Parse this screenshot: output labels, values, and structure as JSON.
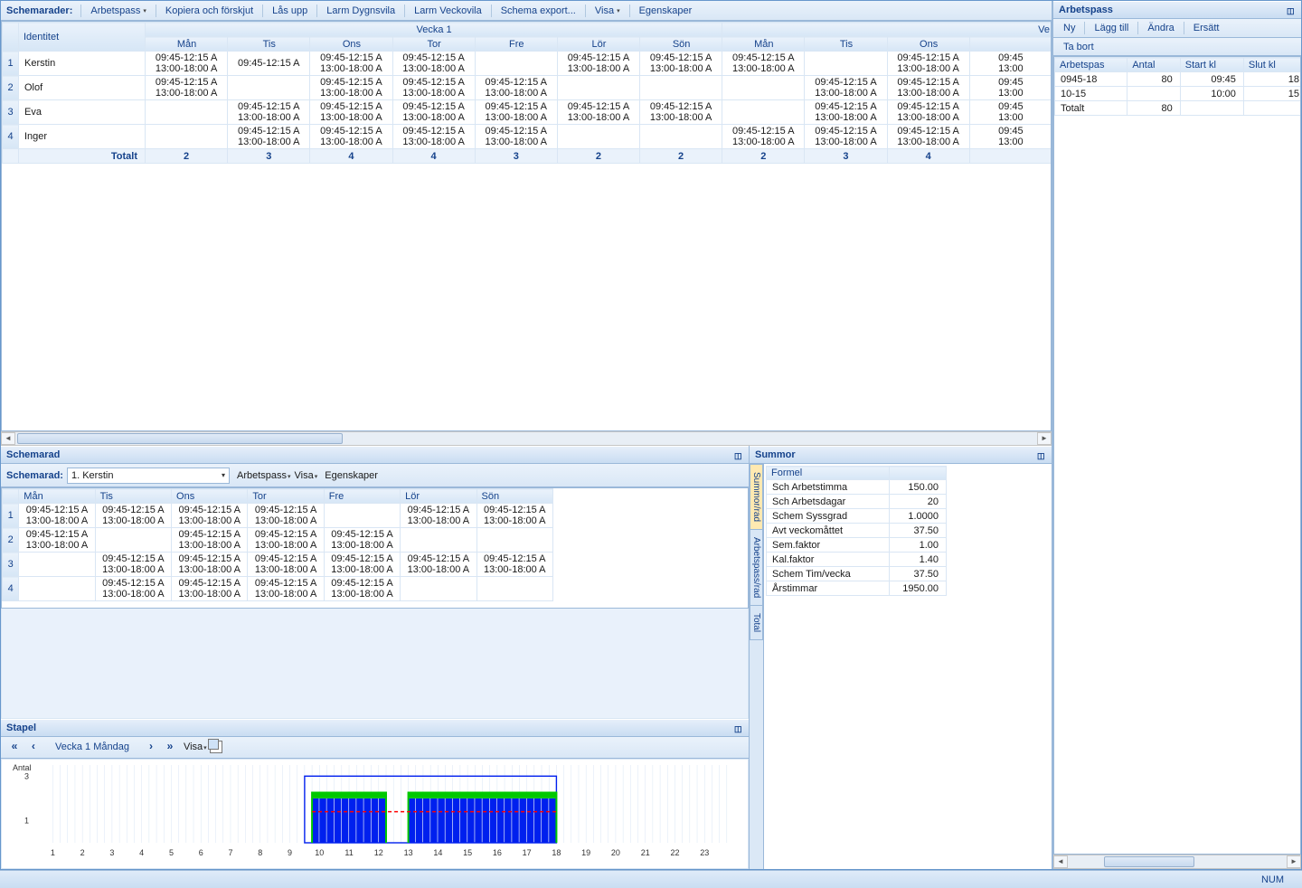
{
  "toolbar": {
    "label": "Schemarader:",
    "arbetspass": "Arbetspass",
    "kopiera": "Kopiera och förskjut",
    "lasupp": "Lås upp",
    "larm_dygn": "Larm Dygnsvila",
    "larm_vecka": "Larm Veckovila",
    "schema_export": "Schema export...",
    "visa": "Visa",
    "egenskaper": "Egenskaper"
  },
  "main_grid": {
    "week_header": "Vecka 1",
    "identitet": "Identitet",
    "days": [
      "Mån",
      "Tis",
      "Ons",
      "Tor",
      "Fre",
      "Lör",
      "Sön",
      "Mån",
      "Tis",
      "Ons",
      ""
    ],
    "partial_header": "Ve",
    "rows": [
      {
        "n": "1",
        "name": "Kerstin",
        "cells": [
          [
            "09:45-12:15 A",
            "13:00-18:00 A"
          ],
          [
            "09:45-12:15 A",
            ""
          ],
          [
            "09:45-12:15 A",
            "13:00-18:00 A"
          ],
          [
            "09:45-12:15 A",
            "13:00-18:00 A"
          ],
          [
            "",
            ""
          ],
          [
            "09:45-12:15 A",
            "13:00-18:00 A"
          ],
          [
            "09:45-12:15 A",
            "13:00-18:00 A"
          ],
          [
            "09:45-12:15 A",
            "13:00-18:00 A"
          ],
          [
            "",
            ""
          ],
          [
            "09:45-12:15 A",
            "13:00-18:00 A"
          ],
          [
            "09:45",
            "13:00"
          ]
        ]
      },
      {
        "n": "2",
        "name": "Olof",
        "cells": [
          [
            "09:45-12:15 A",
            "13:00-18:00 A"
          ],
          [
            "",
            ""
          ],
          [
            "09:45-12:15 A",
            "13:00-18:00 A"
          ],
          [
            "09:45-12:15 A",
            "13:00-18:00 A"
          ],
          [
            "09:45-12:15 A",
            "13:00-18:00 A"
          ],
          [
            "",
            ""
          ],
          [
            "",
            ""
          ],
          [
            "",
            ""
          ],
          [
            "09:45-12:15 A",
            "13:00-18:00 A"
          ],
          [
            "09:45-12:15 A",
            "13:00-18:00 A"
          ],
          [
            "09:45",
            "13:00"
          ]
        ]
      },
      {
        "n": "3",
        "name": "Eva",
        "cells": [
          [
            "",
            ""
          ],
          [
            "09:45-12:15 A",
            "13:00-18:00 A"
          ],
          [
            "09:45-12:15 A",
            "13:00-18:00 A"
          ],
          [
            "09:45-12:15 A",
            "13:00-18:00 A"
          ],
          [
            "09:45-12:15 A",
            "13:00-18:00 A"
          ],
          [
            "09:45-12:15 A",
            "13:00-18:00 A"
          ],
          [
            "09:45-12:15 A",
            "13:00-18:00 A"
          ],
          [
            "",
            ""
          ],
          [
            "09:45-12:15 A",
            "13:00-18:00 A"
          ],
          [
            "09:45-12:15 A",
            "13:00-18:00 A"
          ],
          [
            "09:45",
            "13:00"
          ]
        ]
      },
      {
        "n": "4",
        "name": "Inger",
        "cells": [
          [
            "",
            ""
          ],
          [
            "09:45-12:15 A",
            "13:00-18:00 A"
          ],
          [
            "09:45-12:15 A",
            "13:00-18:00 A"
          ],
          [
            "09:45-12:15 A",
            "13:00-18:00 A"
          ],
          [
            "09:45-12:15 A",
            "13:00-18:00 A"
          ],
          [
            "",
            ""
          ],
          [
            "",
            ""
          ],
          [
            "09:45-12:15 A",
            "13:00-18:00 A"
          ],
          [
            "09:45-12:15 A",
            "13:00-18:00 A"
          ],
          [
            "09:45-12:15 A",
            "13:00-18:00 A"
          ],
          [
            "09:45",
            "13:00"
          ]
        ]
      }
    ],
    "totals_label": "Totalt",
    "totals": [
      "2",
      "3",
      "4",
      "4",
      "3",
      "2",
      "2",
      "2",
      "3",
      "4",
      ""
    ]
  },
  "schemarad_panel": {
    "title": "Schemarad",
    "label": "Schemarad:",
    "combo_value": "1. Kerstin",
    "arbetspass": "Arbetspass",
    "visa": "Visa",
    "egenskaper": "Egenskaper",
    "days": [
      "Mån",
      "Tis",
      "Ons",
      "Tor",
      "Fre",
      "Lör",
      "Sön"
    ],
    "rows": [
      {
        "n": "1",
        "cells": [
          [
            "09:45-12:15 A",
            "13:00-18:00 A"
          ],
          [
            "09:45-12:15 A",
            "13:00-18:00 A"
          ],
          [
            "09:45-12:15 A",
            "13:00-18:00 A"
          ],
          [
            "09:45-12:15 A",
            "13:00-18:00 A"
          ],
          [
            "",
            ""
          ],
          [
            "09:45-12:15 A",
            "13:00-18:00 A"
          ],
          [
            "09:45-12:15 A",
            "13:00-18:00 A"
          ]
        ]
      },
      {
        "n": "2",
        "cells": [
          [
            "09:45-12:15 A",
            "13:00-18:00 A"
          ],
          [
            "",
            ""
          ],
          [
            "09:45-12:15 A",
            "13:00-18:00 A"
          ],
          [
            "09:45-12:15 A",
            "13:00-18:00 A"
          ],
          [
            "09:45-12:15 A",
            "13:00-18:00 A"
          ],
          [
            "",
            ""
          ],
          [
            "",
            ""
          ]
        ]
      },
      {
        "n": "3",
        "cells": [
          [
            "",
            ""
          ],
          [
            "09:45-12:15 A",
            "13:00-18:00 A"
          ],
          [
            "09:45-12:15 A",
            "13:00-18:00 A"
          ],
          [
            "09:45-12:15 A",
            "13:00-18:00 A"
          ],
          [
            "09:45-12:15 A",
            "13:00-18:00 A"
          ],
          [
            "09:45-12:15 A",
            "13:00-18:00 A"
          ],
          [
            "09:45-12:15 A",
            "13:00-18:00 A"
          ]
        ]
      },
      {
        "n": "4",
        "cells": [
          [
            "",
            ""
          ],
          [
            "09:45-12:15 A",
            "13:00-18:00 A"
          ],
          [
            "09:45-12:15 A",
            "13:00-18:00 A"
          ],
          [
            "09:45-12:15 A",
            "13:00-18:00 A"
          ],
          [
            "09:45-12:15 A",
            "13:00-18:00 A"
          ],
          [
            "",
            ""
          ],
          [
            "",
            ""
          ]
        ]
      }
    ]
  },
  "summor": {
    "title": "Summor",
    "tabs": [
      "Summor/rad",
      "Arbetspass/rad",
      "Total"
    ],
    "formel_header": "Formel",
    "rows": [
      [
        "Sch Arbetstimma",
        "150.00"
      ],
      [
        "Sch Arbetsdagar",
        "20"
      ],
      [
        "Schem Syssgrad",
        "1.0000"
      ],
      [
        "Avt veckomåttet",
        "37.50"
      ],
      [
        "Sem.faktor",
        "1.00"
      ],
      [
        "Kal.faktor",
        "1.40"
      ],
      [
        "Schem Tim/vecka",
        "37.50"
      ],
      [
        "Årstimmar",
        "1950.00"
      ]
    ]
  },
  "stapel": {
    "title": "Stapel",
    "nav_label": "Vecka 1  Måndag",
    "visa": "Visa",
    "y_label": "Antal"
  },
  "chart_data": {
    "type": "bar",
    "title": "",
    "xlabel": "",
    "ylabel": "Antal",
    "x_ticks": [
      1,
      2,
      3,
      4,
      5,
      6,
      7,
      8,
      9,
      10,
      11,
      12,
      13,
      14,
      15,
      16,
      17,
      18,
      19,
      20,
      21,
      22,
      23
    ],
    "ylim": [
      0,
      3.5
    ],
    "y_ticks": [
      1,
      3
    ],
    "series": [
      {
        "name": "band_blue",
        "color": "#0020ee",
        "intervals": [
          [
            9.75,
            12.25
          ],
          [
            13.0,
            18.0
          ]
        ],
        "value": 2
      },
      {
        "name": "need_outline",
        "color": "#0020ee",
        "intervals": [
          [
            9.5,
            18.0
          ]
        ],
        "value": 3,
        "style": "outline"
      },
      {
        "name": "mid_green",
        "color": "#00c800",
        "intervals": [
          [
            9.75,
            12.25
          ],
          [
            13.0,
            18.0
          ]
        ],
        "value": 2.3
      },
      {
        "name": "mid_red_dash",
        "color": "#ff0000",
        "intervals": [
          [
            9.75,
            18.0
          ]
        ],
        "value": 1.4,
        "style": "dashed"
      }
    ]
  },
  "arbetspass_panel": {
    "title": "Arbetspass",
    "buttons": {
      "ny": "Ny",
      "lagg_till": "Lägg till",
      "andra": "Ändra",
      "ersatt": "Ersätt",
      "ta_bort": "Ta bort"
    },
    "headers": [
      "Arbetspas",
      "Antal",
      "Start kl",
      "Slut kl"
    ],
    "rows": [
      [
        "0945-18",
        "80",
        "09:45",
        "18"
      ],
      [
        "10-15",
        "",
        "10:00",
        "15"
      ]
    ],
    "totals_label": "Totalt",
    "totals_val": "80"
  },
  "status": {
    "num": "NUM"
  }
}
